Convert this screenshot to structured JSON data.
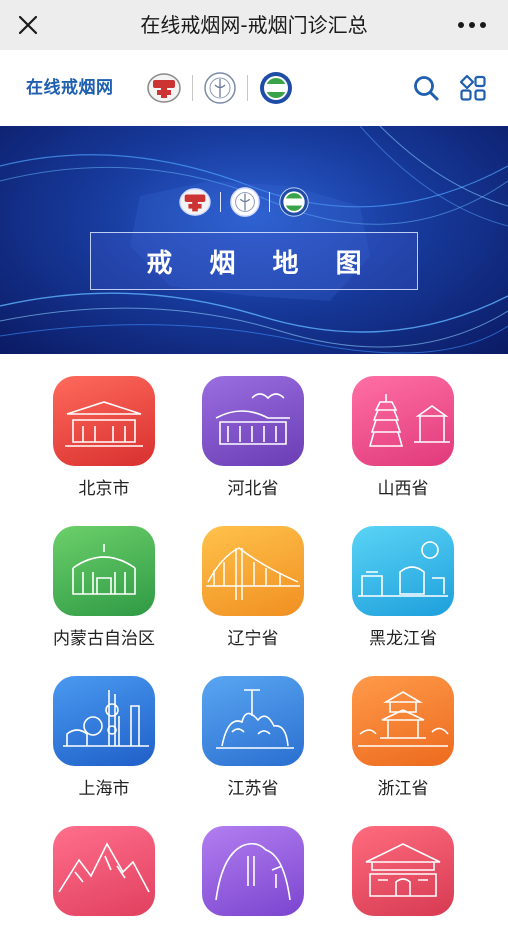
{
  "topbar": {
    "title": "在线戒烟网-戒烟门诊汇总"
  },
  "header": {
    "site_name": "在线戒烟网"
  },
  "banner": {
    "title": "戒 烟 地 图"
  },
  "provinces": [
    {
      "label": "北京市",
      "color": "#e8413f"
    },
    {
      "label": "河北省",
      "color": "#7b4fc4"
    },
    {
      "label": "山西省",
      "color": "#ec4f8c"
    },
    {
      "label": "内蒙古自治区",
      "color": "#4db25a"
    },
    {
      "label": "辽宁省",
      "color": "#f2a732"
    },
    {
      "label": "黑龙江省",
      "color": "#3ab8e6"
    },
    {
      "label": "上海市",
      "color": "#2f7bd9"
    },
    {
      "label": "江苏省",
      "color": "#3f86dc"
    },
    {
      "label": "浙江省",
      "color": "#f2802c"
    },
    {
      "label": "",
      "color": "#ea4a6e"
    },
    {
      "label": "",
      "color": "#8d5ad6"
    },
    {
      "label": "",
      "color": "#e4475e"
    }
  ],
  "colors": {
    "topbar_bg": "#ededed",
    "brand_blue": "#1f5fb0",
    "banner_blue": "#173a9c"
  },
  "icons": [
    "close-icon",
    "more-icon",
    "search-icon",
    "grid-menu-icon"
  ]
}
